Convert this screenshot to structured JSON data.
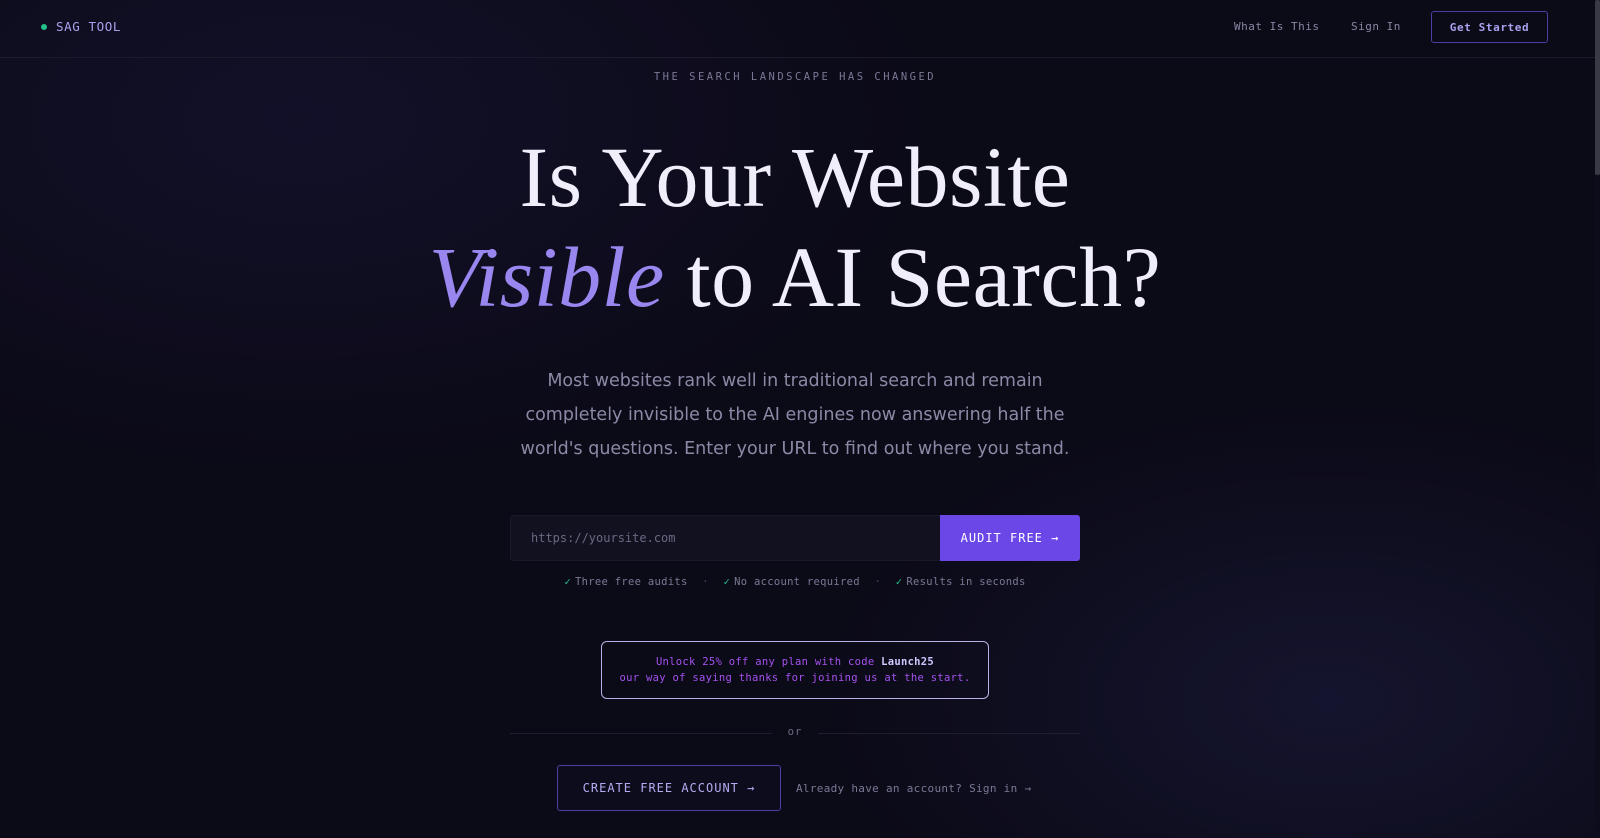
{
  "nav": {
    "brand": "SAG TOOL",
    "links": [
      "What Is This",
      "Sign In"
    ],
    "cta": "Get Started"
  },
  "hero": {
    "eyebrow": "THE SEARCH LANDSCAPE HAS CHANGED",
    "headline_line1": "Is Your Website",
    "headline_accent": "Visible",
    "headline_line2_rest": " to AI Search?",
    "subhead": "Most websites rank well in traditional search and remain completely invisible to the AI engines now answering half the world's questions. Enter your URL to find out where you stand."
  },
  "audit_form": {
    "input_value": "",
    "placeholder": "https://yoursite.com",
    "button_label": "AUDIT FREE →"
  },
  "perks": {
    "check": "✓",
    "separator": "·",
    "items": [
      "Three free audits",
      "No account required",
      "Results in seconds"
    ]
  },
  "promo": {
    "line1_prefix": "Unlock 25% off any plan with code ",
    "code": "Launch25",
    "line2": "our way of saying thanks for joining us at the start."
  },
  "divider_text": "or",
  "create_account": {
    "button_label": "CREATE FREE ACCOUNT →",
    "signin_text": "Already have an account? Sign in →"
  },
  "colors": {
    "background": "#0b0a17",
    "accent_purple": "#6b47e8",
    "accent_lavender": "#9a86ef",
    "success_green": "#22c28a",
    "promo_magenta": "#a552f0"
  },
  "icons": {
    "brand_status": "status-dot-icon",
    "check": "check-icon",
    "arrow": "arrow-right-icon"
  }
}
